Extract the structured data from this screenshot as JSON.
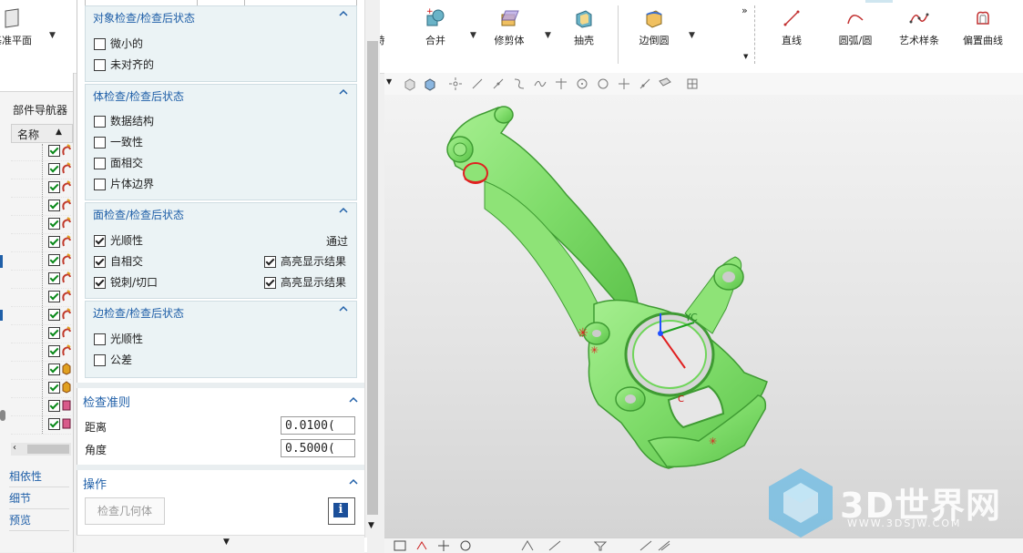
{
  "ribbon": {
    "datum_plane": "基准平面",
    "feature_partial": "特",
    "unite": "合并",
    "trim_body": "修剪体",
    "shell": "抽壳",
    "edge_blend": "边倒圆",
    "line": "直线",
    "arc_circle": "圆弧/圆",
    "studio_spline": "艺术样条",
    "offset_curve": "偏置曲线",
    "more": "»"
  },
  "left_nav": {
    "part_navigator": "部件导航器",
    "name_col": "名称",
    "dependencies": "相依性",
    "details": "细节",
    "preview": "预览"
  },
  "dialog": {
    "object_group": {
      "title": "对象检查/检查后状态",
      "items": [
        {
          "label": "微小的",
          "checked": false
        },
        {
          "label": "未对齐的",
          "checked": false
        }
      ]
    },
    "body_group": {
      "title": "体检查/检查后状态",
      "items": [
        {
          "label": "数据结构",
          "checked": false
        },
        {
          "label": "一致性",
          "checked": false
        },
        {
          "label": "面相交",
          "checked": false
        },
        {
          "label": "片体边界",
          "checked": false
        }
      ]
    },
    "face_group": {
      "title": "面检查/检查后状态",
      "smoothness": {
        "label": "光顺性",
        "checked": true,
        "status": "通过"
      },
      "self_intersect": {
        "label": "自相交",
        "checked": true,
        "highlight_label": "高亮显示结果",
        "highlight_checked": true
      },
      "spikes": {
        "label": "锐刺/切口",
        "checked": true,
        "highlight_label": "高亮显示结果",
        "highlight_checked": true
      }
    },
    "edge_group": {
      "title": "边检查/检查后状态",
      "items": [
        {
          "label": "光顺性",
          "checked": false
        },
        {
          "label": "公差",
          "checked": false
        }
      ]
    },
    "criteria": {
      "title": "检查准则",
      "distance_label": "距离",
      "distance_value": "0.0100(",
      "angle_label": "角度",
      "angle_value": "0.5000("
    },
    "operation": {
      "title": "操作",
      "check_geometry": "检查几何体",
      "info_glyph": "i"
    }
  },
  "viewport": {
    "axis_yc": "YC",
    "axis_c": "C",
    "watermark_title": "3D世界网",
    "watermark_url": "WWW.3DSJW.COM"
  },
  "colors": {
    "part_green": "#7fdc6a",
    "part_green_dark": "#3f9b33",
    "accent_blue": "#1f5fa8",
    "group_bg": "#ebf3f5"
  }
}
